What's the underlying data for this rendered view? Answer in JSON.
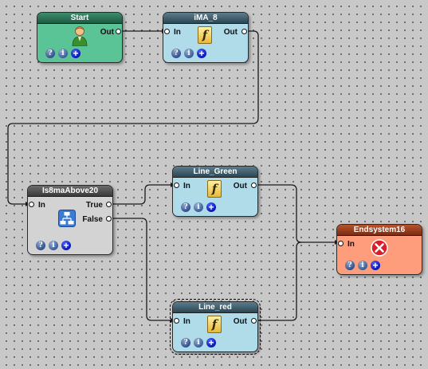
{
  "nodes": {
    "start": {
      "title": "Start",
      "ports": {
        "out": "Out"
      },
      "icon": "user-icon",
      "buttons": {
        "help": "?",
        "info": "i",
        "add": "+"
      }
    },
    "ima8": {
      "title": "iMA_8",
      "ports": {
        "in": "In",
        "out": "Out"
      },
      "icon": "function-icon",
      "icon_glyph": "f",
      "buttons": {
        "help": "?",
        "info": "i",
        "add": "+"
      }
    },
    "is8maabove20": {
      "title": "Is8maAbove20",
      "ports": {
        "in": "In",
        "true": "True",
        "false": "False"
      },
      "icon": "condition-icon",
      "buttons": {
        "help": "?",
        "info": "i",
        "add": "+"
      }
    },
    "line_green": {
      "title": "Line_Green",
      "ports": {
        "in": "In",
        "out": "Out"
      },
      "icon": "function-icon",
      "icon_glyph": "f",
      "buttons": {
        "help": "?",
        "info": "i",
        "add": "+"
      }
    },
    "line_red": {
      "title": "Line_red",
      "ports": {
        "in": "In",
        "out": "Out"
      },
      "icon": "function-icon",
      "icon_glyph": "f",
      "buttons": {
        "help": "?",
        "info": "i",
        "add": "+"
      }
    },
    "endsystem16": {
      "title": "Endsystem16",
      "ports": {
        "in": "In"
      },
      "icon": "stop-icon",
      "buttons": {
        "help": "?",
        "info": "i",
        "add": "+"
      }
    }
  },
  "connections": [
    {
      "from": "Start.Out",
      "to": "iMA_8.In"
    },
    {
      "from": "iMA_8.Out",
      "to": "Is8maAbove20.In"
    },
    {
      "from": "Is8maAbove20.True",
      "to": "Line_Green.In"
    },
    {
      "from": "Is8maAbove20.False",
      "to": "Line_red.In"
    },
    {
      "from": "Line_Green.Out",
      "to": "Endsystem16.In"
    },
    {
      "from": "Line_red.Out",
      "to": "Endsystem16.In"
    }
  ],
  "colors": {
    "start": "#5ac496",
    "function": "#b0dbe8",
    "condition": "#d3d3d3",
    "end": "#fd9d7b",
    "canvas": "#c8c8c8"
  },
  "selected_node": "Line_red"
}
